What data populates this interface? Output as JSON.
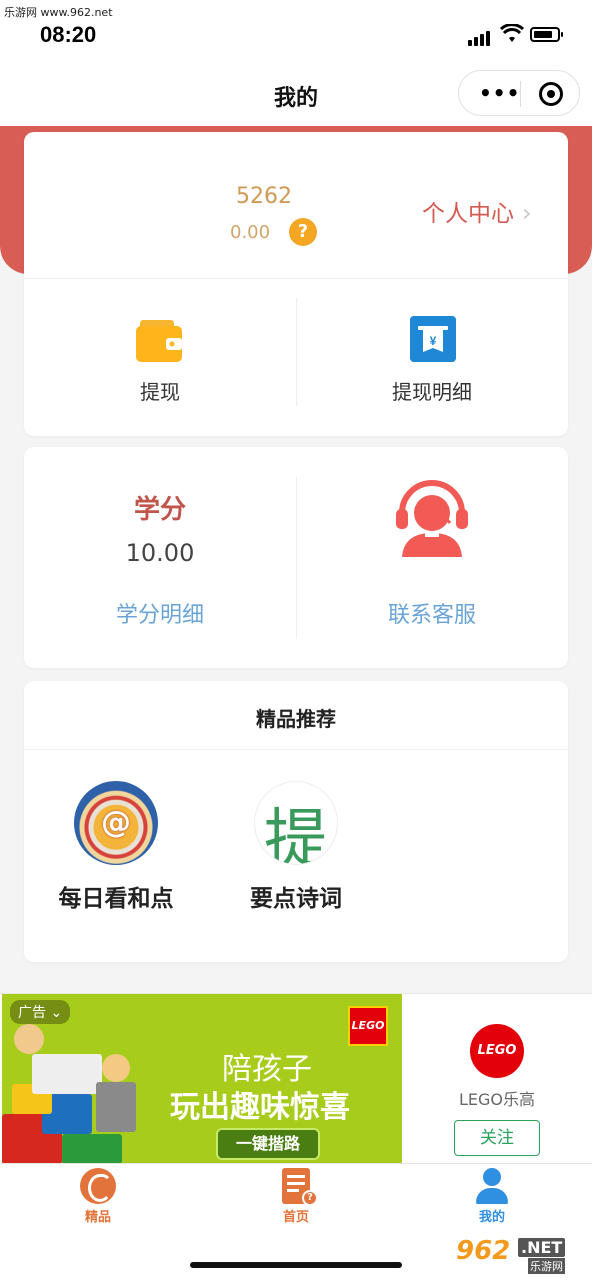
{
  "watermarks": {
    "top_left": "乐游网 www.962.net",
    "bottom_right_num": "962",
    "bottom_right_net": ".NET",
    "bottom_right_sub": "乐游网"
  },
  "status": {
    "time": "08:20"
  },
  "nav": {
    "title": "我的",
    "more": "•••"
  },
  "account": {
    "score": "5262",
    "money": "0.00",
    "help": "?",
    "profile_link": "个人中心",
    "chevron": "›",
    "withdraw": "提现",
    "withdraw_detail": "提现明细"
  },
  "credit": {
    "title": "学分",
    "value": "10.00",
    "detail_link": "学分明细",
    "service_link": "联系客服"
  },
  "recommend": {
    "title": "精品推荐",
    "apps": [
      {
        "name": "每日看和点",
        "icon_glyph": "@"
      },
      {
        "name": "要点诗词",
        "icon_glyph": "提"
      }
    ]
  },
  "ad": {
    "tag": "广告 ⌄",
    "brand_badge": "LEGO",
    "line1": "陪孩子",
    "line2": "玩出趣味惊喜",
    "cta": "一键揩路",
    "brand_name": "LEGO乐高",
    "follow": "关注"
  },
  "tabbar": {
    "tabs": [
      {
        "label": "精品",
        "color": "#e2733a"
      },
      {
        "label": "首页",
        "color": "#e2733a"
      },
      {
        "label": "我的",
        "color": "#2f8fe0"
      }
    ]
  },
  "colors": {
    "accent_red": "#d85d54",
    "link_blue": "#6aa4d6",
    "brand_green": "#2aa15c"
  }
}
